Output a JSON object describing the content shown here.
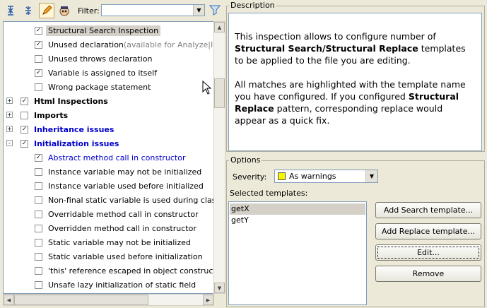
{
  "toolbar": {
    "filter_label": "Filter:",
    "filter_value": ""
  },
  "tree": {
    "rows": [
      {
        "label": "Structural Search Inspection",
        "checked": true,
        "level": 2,
        "style": "selected"
      },
      {
        "label": "Unused declaration",
        "suffix": " (available for Analyze|Inspect",
        "checked": true,
        "level": 2,
        "style": "normal"
      },
      {
        "label": "Unused throws declaration",
        "checked": false,
        "level": 2,
        "style": "normal"
      },
      {
        "label": "Variable is assigned to itself",
        "checked": true,
        "level": 2,
        "style": "normal"
      },
      {
        "label": "Wrong package statement",
        "checked": false,
        "level": 2,
        "style": "normal"
      },
      {
        "label": "Html Inspections",
        "checked": true,
        "level": 1,
        "style": "group",
        "expander": "+"
      },
      {
        "label": "Imports",
        "checked": false,
        "level": 1,
        "style": "group",
        "expander": "+"
      },
      {
        "label": "Inheritance issues",
        "checked": true,
        "level": 1,
        "style": "group-blue",
        "expander": "+"
      },
      {
        "label": "Initialization issues",
        "checked": true,
        "level": 1,
        "style": "group-blue",
        "expander": "-"
      },
      {
        "label": "Abstract method call in constructor",
        "checked": true,
        "level": 2,
        "style": "blue"
      },
      {
        "label": "Instance variable may not be initialized",
        "checked": false,
        "level": 2,
        "style": "normal"
      },
      {
        "label": "Instance variable used before initialized",
        "checked": false,
        "level": 2,
        "style": "normal"
      },
      {
        "label": "Non-final static variable is used during class initia",
        "checked": false,
        "level": 2,
        "style": "normal"
      },
      {
        "label": "Overridable method call in constructor",
        "checked": false,
        "level": 2,
        "style": "normal"
      },
      {
        "label": "Overridden method call in constructor",
        "checked": false,
        "level": 2,
        "style": "normal"
      },
      {
        "label": "Static variable may not be initialized",
        "checked": false,
        "level": 2,
        "style": "normal"
      },
      {
        "label": "Static variable used before initialization",
        "checked": false,
        "level": 2,
        "style": "normal"
      },
      {
        "label": "'this' reference escaped in object construction",
        "checked": false,
        "level": 2,
        "style": "normal"
      },
      {
        "label": "Unsafe lazy initialization of static field",
        "checked": false,
        "level": 2,
        "style": "normal"
      }
    ]
  },
  "description": {
    "legend": "Description",
    "para1_pre": "This inspection allows to configure number of ",
    "para1_bold": "Structural Search/Structural Replace",
    "para1_post": " templates to be applied to the file you are editing.",
    "para2_pre": "All matches are highlighted with the template name you have configured. If you configured ",
    "para2_bold": "Structural Replace",
    "para2_post": " pattern, corresponding replace would appear as a quick fix."
  },
  "options": {
    "legend": "Options",
    "severity_label": "Severity:",
    "severity_value": "As warnings",
    "severity_color": "#f5f500",
    "templates_label": "Selected templates:",
    "templates": [
      "getX",
      "getY"
    ],
    "buttons": {
      "add_search": "Add Search template...",
      "add_replace": "Add Replace template...",
      "edit": "Edit...",
      "remove": "Remove"
    }
  }
}
